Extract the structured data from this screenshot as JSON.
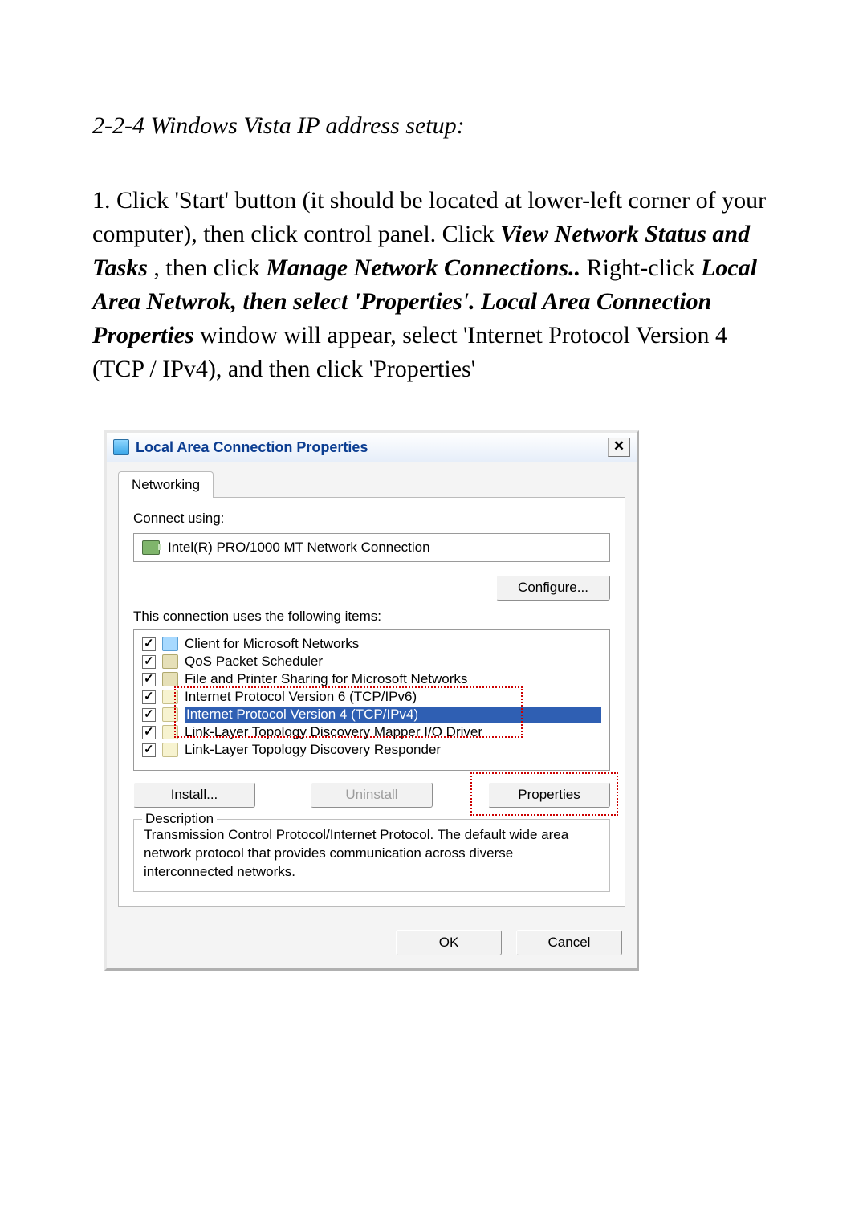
{
  "doc": {
    "section_heading": "2-2-4 Windows Vista IP address setup:",
    "instruction_prefix": "1. Click 'Start' button (it should be located at lower-left corner of your computer), then click control panel. Click ",
    "bi1": "View Network Status and Tasks",
    "mid1": ", then click ",
    "bi2": "Manage Network Connections..",
    "mid2": "Right-click ",
    "bi3": "Local Area Netwrok, then select 'Properties'. Local Area Connection Properties",
    "instruction_suffix": " window will appear, select 'Internet Protocol Version 4 (TCP / IPv4), and then click 'Properties'"
  },
  "dialog": {
    "title": "Local Area Connection Properties",
    "close_glyph": "✕",
    "tab_networking": "Networking",
    "connect_using_label": "Connect using:",
    "adapter_name": "Intel(R) PRO/1000 MT Network Connection",
    "configure_btn": "Configure...",
    "items_label": "This connection uses the following items:",
    "items": [
      {
        "label": "Client for Microsoft Networks",
        "icon": "net",
        "checked": true,
        "selected": false
      },
      {
        "label": "QoS Packet Scheduler",
        "icon": "sched",
        "checked": true,
        "selected": false
      },
      {
        "label": "File and Printer Sharing for Microsoft Networks",
        "icon": "share",
        "checked": true,
        "selected": false
      },
      {
        "label": "Internet Protocol Version 6 (TCP/IPv6)",
        "icon": "proto",
        "checked": true,
        "selected": false
      },
      {
        "label": "Internet Protocol Version 4 (TCP/IPv4)",
        "icon": "proto",
        "checked": true,
        "selected": true
      },
      {
        "label": "Link-Layer Topology Discovery Mapper I/O Driver",
        "icon": "proto",
        "checked": true,
        "selected": false
      },
      {
        "label": "Link-Layer Topology Discovery Responder",
        "icon": "proto",
        "checked": true,
        "selected": false
      }
    ],
    "install_btn": "Install...",
    "uninstall_btn": "Uninstall",
    "properties_btn": "Properties",
    "description_legend": "Description",
    "description_text": "Transmission Control Protocol/Internet Protocol. The default wide area network protocol that provides communication across diverse interconnected networks.",
    "ok_btn": "OK",
    "cancel_btn": "Cancel"
  }
}
